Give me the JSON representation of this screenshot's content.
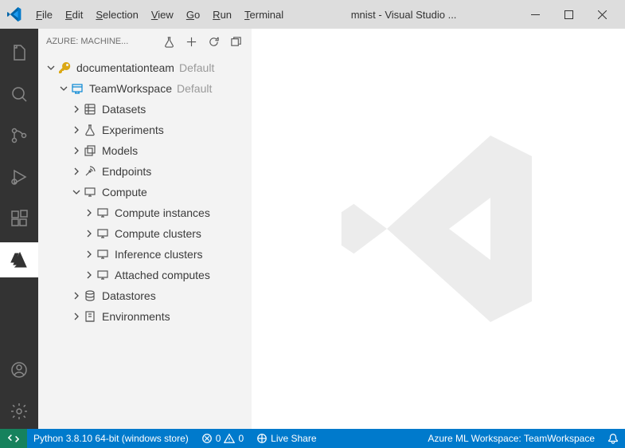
{
  "titlebar": {
    "menu": [
      "File",
      "Edit",
      "Selection",
      "View",
      "Go",
      "Run",
      "Terminal"
    ],
    "title": "mnist - Visual Studio ..."
  },
  "sidebar": {
    "header_title": "AZURE: MACHINE...",
    "sub": {
      "name": "documentationteam",
      "desc": "Default",
      "ws": {
        "name": "TeamWorkspace",
        "desc": "Default",
        "nodes": {
          "datasets": "Datasets",
          "experiments": "Experiments",
          "models": "Models",
          "endpoints": "Endpoints",
          "compute": "Compute",
          "compute_children": {
            "instances": "Compute instances",
            "clusters": "Compute clusters",
            "inference": "Inference clusters",
            "attached": "Attached computes"
          },
          "datastores": "Datastores",
          "environments": "Environments"
        }
      }
    }
  },
  "statusbar": {
    "python": "Python 3.8.10 64-bit (windows store)",
    "errors": "0",
    "warnings": "0",
    "liveshare": "Live Share",
    "azure_ws": "Azure ML Workspace: TeamWorkspace"
  }
}
